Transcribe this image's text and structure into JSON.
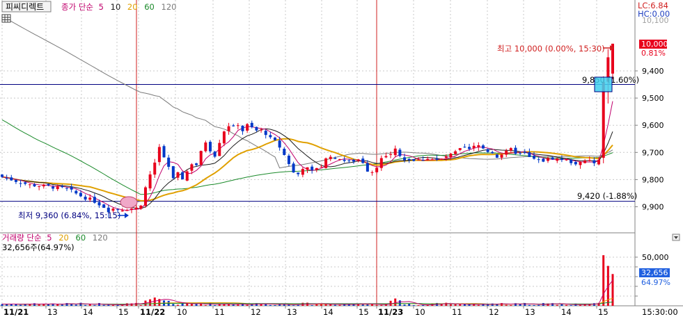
{
  "stock_name": "피씨디렉트",
  "price_legend": {
    "prefix": "종가 단순",
    "ma": [
      "5",
      "10",
      "20",
      "60",
      "120"
    ]
  },
  "volume_legend": {
    "prefix": "거래량 단순",
    "ma": [
      "5",
      "20",
      "60",
      "120"
    ]
  },
  "volume_info": "32,656주(64.97%)",
  "lc_label": "LC:6.84",
  "hc_label": "HC:0.00",
  "top_clip_label": "10,100",
  "high_annotation": "최고 10,000 (0.00%, 15:30)",
  "low_annotation": "최저 9,360 (6.84%, 15:15)",
  "current_line_label": "9,850 (1.60%)",
  "lower_line_label": "9,420 (-1.88%)",
  "price_badge": {
    "value": "10,000",
    "pct": "0.81%"
  },
  "volume_badge": {
    "value": "32,656",
    "pct": "64.97%"
  },
  "time_label": "15:30:00",
  "price_ticks": [
    "9,900",
    "9,800",
    "9,700",
    "9,600",
    "9,500",
    "9,400"
  ],
  "volume_ticks": [
    "50,000",
    "40,000",
    "30,000",
    "20,000",
    "10,000"
  ],
  "x_labels": [
    "11/21",
    "13",
    "14",
    "15",
    "11/22",
    "10",
    "11",
    "12",
    "13",
    "14",
    "15",
    "11/23",
    "10",
    "11",
    "12",
    "13",
    "14",
    "15"
  ],
  "colors": {
    "up": "#e8001c",
    "down": "#0038c8",
    "ma5": "#c0006c",
    "ma10": "#1a1a1a",
    "ma20": "#e0a000",
    "ma60": "#1a8a2a",
    "ma120": "#7a7a7a",
    "grid": "#c8c8c8",
    "ref_line": "#000080",
    "day_line": "#d02020"
  },
  "chart_data": {
    "type": "candlestick",
    "x": [
      "11/21",
      "11/22",
      "11/23"
    ],
    "xlabels": [
      "11/21",
      "13",
      "14",
      "15",
      "11/22",
      "10",
      "11",
      "12",
      "13",
      "14",
      "15",
      "11/23",
      "10",
      "11",
      "12",
      "13",
      "14",
      "15"
    ],
    "ylim": [
      9340,
      10100
    ],
    "yticks": [
      9400,
      9500,
      9600,
      9700,
      9800,
      9900
    ],
    "volume_ylim": [
      0,
      55000
    ],
    "volume_yticks": [
      10000,
      20000,
      30000,
      40000,
      50000
    ],
    "reference_lines": [
      9850,
      9420
    ],
    "high": {
      "value": 10000,
      "pct": "0.00%",
      "time": "15:30"
    },
    "low": {
      "value": 9360,
      "pct": "6.84%",
      "time": "15:15"
    },
    "last_price": 10000,
    "last_volume": 32656,
    "series": [
      {
        "name": "5",
        "values": []
      },
      {
        "name": "10",
        "values": []
      },
      {
        "name": "20",
        "values": []
      },
      {
        "name": "60",
        "values": []
      },
      {
        "name": "120",
        "values": []
      }
    ],
    "price_path": [
      [
        0,
        9510
      ],
      [
        2,
        9500
      ],
      [
        6,
        9480
      ],
      [
        10,
        9475
      ],
      [
        14,
        9465
      ],
      [
        17,
        9440
      ],
      [
        20,
        9420
      ],
      [
        22,
        9400
      ],
      [
        25,
        9390
      ],
      [
        29,
        9395
      ],
      [
        30,
        9410
      ],
      [
        31,
        9470
      ],
      [
        32,
        9520
      ],
      [
        33,
        9560
      ],
      [
        34,
        9620
      ],
      [
        35,
        9580
      ],
      [
        36,
        9545
      ],
      [
        37,
        9500
      ],
      [
        38,
        9520
      ],
      [
        39,
        9505
      ],
      [
        40,
        9530
      ],
      [
        41,
        9560
      ],
      [
        42,
        9555
      ],
      [
        43,
        9600
      ],
      [
        44,
        9640
      ],
      [
        45,
        9610
      ],
      [
        46,
        9590
      ],
      [
        47,
        9640
      ],
      [
        48,
        9680
      ],
      [
        49,
        9700
      ],
      [
        50,
        9690
      ],
      [
        51,
        9705
      ],
      [
        52,
        9680
      ],
      [
        53,
        9700
      ],
      [
        54,
        9690
      ],
      [
        55,
        9680
      ],
      [
        56,
        9680
      ],
      [
        57,
        9670
      ],
      [
        58,
        9650
      ],
      [
        59,
        9640
      ],
      [
        60,
        9620
      ],
      [
        61,
        9590
      ],
      [
        62,
        9560
      ],
      [
        63,
        9525
      ],
      [
        64,
        9520
      ],
      [
        65,
        9545
      ],
      [
        66,
        9540
      ],
      [
        67,
        9530
      ],
      [
        68,
        9545
      ],
      [
        69,
        9550
      ],
      [
        70,
        9575
      ],
      [
        71,
        9590
      ],
      [
        72,
        9570
      ],
      [
        73,
        9580
      ],
      [
        74,
        9570
      ],
      [
        75,
        9565
      ],
      [
        76,
        9570
      ],
      [
        77,
        9575
      ],
      [
        78,
        9565
      ],
      [
        79,
        9535
      ],
      [
        80,
        9530
      ],
      [
        81,
        9550
      ],
      [
        82,
        9575
      ],
      [
        83,
        9580
      ],
      [
        84,
        9595
      ],
      [
        85,
        9610
      ],
      [
        86,
        9585
      ],
      [
        87,
        9575
      ],
      [
        88,
        9575
      ],
      [
        89,
        9570
      ],
      [
        90,
        9570
      ],
      [
        91,
        9575
      ],
      [
        92,
        9580
      ],
      [
        93,
        9575
      ],
      [
        94,
        9570
      ],
      [
        95,
        9575
      ],
      [
        96,
        9585
      ],
      [
        97,
        9590
      ],
      [
        98,
        9600
      ],
      [
        99,
        9610
      ],
      [
        100,
        9615
      ],
      [
        101,
        9610
      ],
      [
        102,
        9620
      ],
      [
        103,
        9625
      ],
      [
        104,
        9615
      ],
      [
        105,
        9605
      ],
      [
        106,
        9600
      ],
      [
        107,
        9585
      ],
      [
        108,
        9595
      ],
      [
        109,
        9600
      ],
      [
        110,
        9610
      ],
      [
        111,
        9600
      ],
      [
        112,
        9595
      ],
      [
        113,
        9595
      ],
      [
        114,
        9580
      ],
      [
        115,
        9575
      ],
      [
        116,
        9570
      ],
      [
        117,
        9570
      ],
      [
        118,
        9575
      ],
      [
        119,
        9580
      ],
      [
        120,
        9575
      ],
      [
        121,
        9575
      ],
      [
        122,
        9570
      ],
      [
        123,
        9565
      ],
      [
        124,
        9560
      ],
      [
        125,
        9560
      ],
      [
        126,
        9565
      ],
      [
        127,
        9570
      ],
      [
        128,
        9560
      ],
      [
        129,
        9570
      ],
      [
        130,
        9860
      ],
      [
        131,
        9950
      ],
      [
        132,
        10000
      ]
    ]
  }
}
